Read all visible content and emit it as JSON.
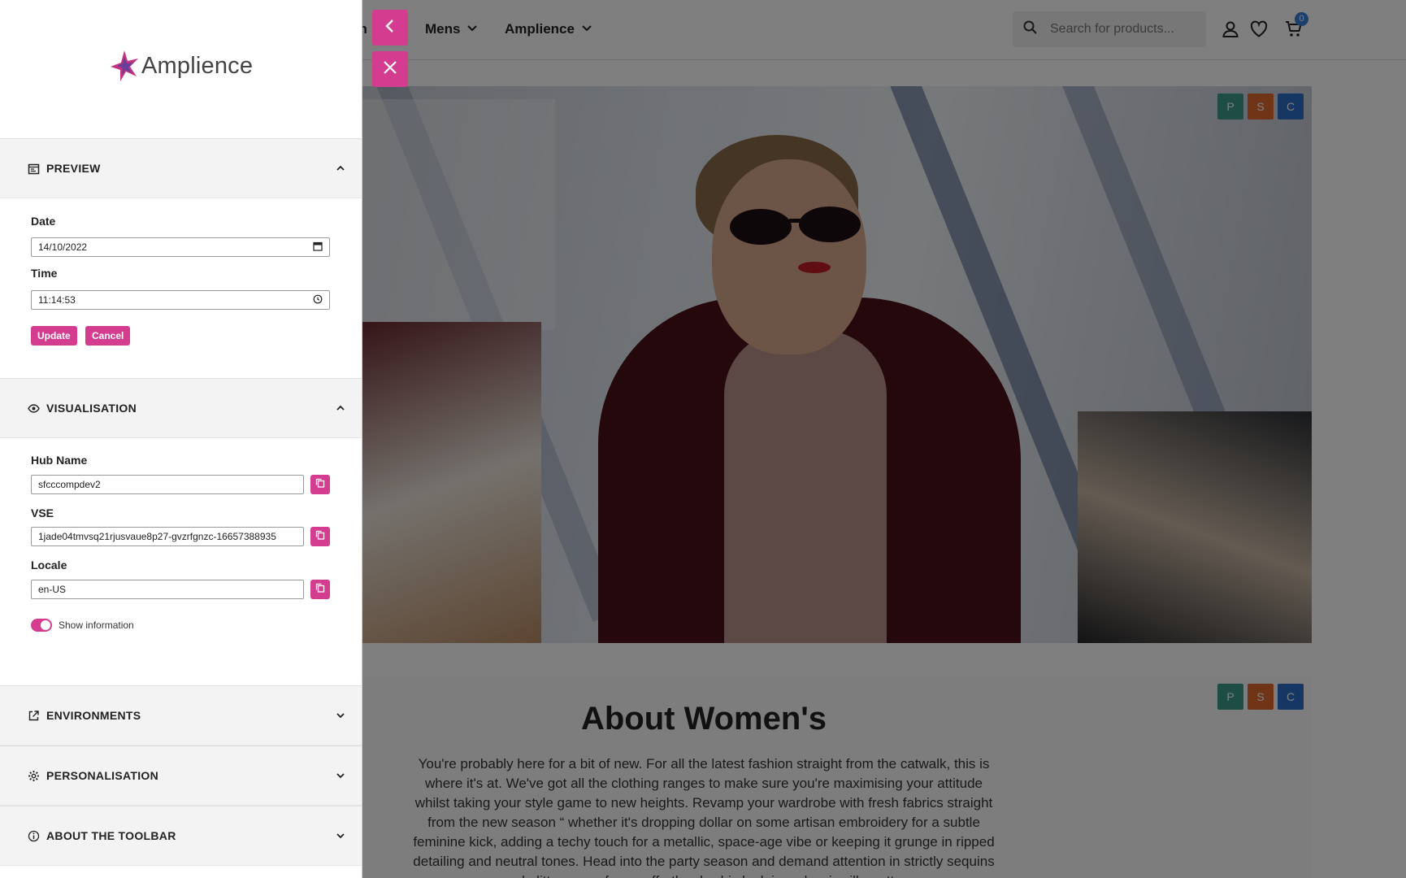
{
  "nav": {
    "partial_label": "en",
    "items": [
      {
        "label": "Mens"
      },
      {
        "label": "Amplience"
      }
    ]
  },
  "search": {
    "placeholder": "Search for products..."
  },
  "cart": {
    "count": "0"
  },
  "hero": {
    "badges": [
      "P",
      "S",
      "C"
    ]
  },
  "about": {
    "badges": [
      "P",
      "S",
      "C"
    ],
    "title": "About Women's",
    "text": "You're probably here for a bit of new. For all the latest fashion straight from the catwalk, this is where it's at. We've got all the clothing ranges to make sure you're maximising your attitude whilst taking your style game to new heights. Revamp your wardrobe with fresh fabrics straight from the new season “ whether it's dropping dollar on some artisan embroidery for a subtle feminine kick, adding a techy touch for a metallic, space-age vibe or keeping it grunge in ripped detailing and neutral tones. Head into the party season and demand attention in strictly sequins and glitter, or go for an effortlessly chic look in a classic silhouette."
  },
  "toolbar": {
    "logo_text": "Amplience",
    "preview": {
      "title": "PREVIEW",
      "date_label": "Date",
      "date_value": "14/10/2022",
      "time_label": "Time",
      "time_value": "11:14:53",
      "update_label": "Update",
      "cancel_label": "Cancel"
    },
    "visualisation": {
      "title": "VISUALISATION",
      "hub_label": "Hub Name",
      "hub_value": "sfcccompdev2",
      "vse_label": "VSE",
      "vse_value": "1jade04tmvsq21rjusvaue8p27-gvzrfgnzc-16657388935",
      "locale_label": "Locale",
      "locale_value": "en-US",
      "toggle_label": "Show information",
      "toggle_on": true
    },
    "environments": {
      "title": "ENVIRONMENTS"
    },
    "personalisation": {
      "title": "PERSONALISATION"
    },
    "about_toolbar": {
      "title": "ABOUT THE TOOLBAR"
    }
  },
  "colors": {
    "accent": "#d33c8f",
    "badge_p": "#3a9a8a",
    "badge_s": "#e06a2e",
    "badge_c": "#2c6ec8",
    "cart_badge": "#3b7fd8"
  },
  "icons": {
    "back": "chevron-left-icon",
    "close": "close-icon",
    "search": "search-icon",
    "account": "account-icon",
    "wishlist": "heart-icon",
    "cart": "cart-icon",
    "preview": "calendar-icon",
    "visualisation": "eye-icon",
    "environments": "external-link-icon",
    "personalisation": "gear-icon",
    "about_toolbar": "info-icon",
    "copy": "copy-icon"
  }
}
